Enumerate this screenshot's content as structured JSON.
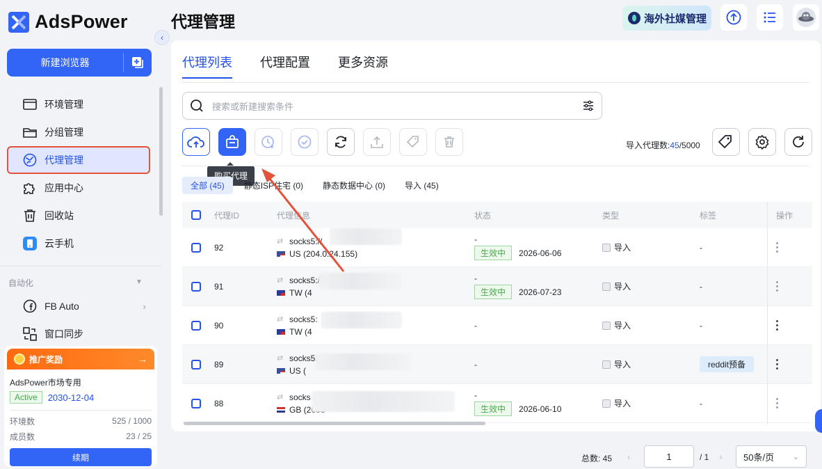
{
  "app": {
    "name": "AdsPower"
  },
  "sidebar": {
    "new_browser": "新建浏览器",
    "items": [
      {
        "label": "环境管理",
        "icon": "window-icon"
      },
      {
        "label": "分组管理",
        "icon": "folder-icon"
      },
      {
        "label": "代理管理",
        "icon": "proxy-icon",
        "active": true
      },
      {
        "label": "应用中心",
        "icon": "puzzle-icon"
      },
      {
        "label": "回收站",
        "icon": "trash-icon"
      },
      {
        "label": "云手机",
        "icon": "cloud-phone-icon"
      }
    ],
    "automation_label": "自动化",
    "auto_items": [
      {
        "label": "FB Auto",
        "icon": "facebook-icon"
      },
      {
        "label": "窗口同步",
        "icon": "sync-window-icon"
      }
    ]
  },
  "promo": {
    "title": "推广奖励",
    "plan_name": "AdsPower市场专用",
    "status": "Active",
    "expire": "2030-12-04",
    "env_label": "环境数",
    "env_value": "525 / 1000",
    "member_label": "成员数",
    "member_value": "23 / 25",
    "renew": "续期"
  },
  "header": {
    "title": "代理管理",
    "social_btn": "海外社媒管理"
  },
  "tabs": [
    "代理列表",
    "代理配置",
    "更多资源"
  ],
  "search": {
    "placeholder": "搜索或新建搜索条件"
  },
  "toolbar": {
    "tooltip": "购买代理",
    "import_label": "导入代理数:",
    "import_used": "45",
    "import_total": "/5000"
  },
  "filters": [
    {
      "label": "全部 (45)",
      "active": true
    },
    {
      "label": "静态ISP住宅 (0)"
    },
    {
      "label": "静态数据中心 (0)"
    },
    {
      "label": "导入 (45)"
    }
  ],
  "table": {
    "headers": {
      "id": "代理ID",
      "info": "代理信息",
      "status": "状态",
      "type": "类型",
      "tag": "标签",
      "op": "操作"
    },
    "rows": [
      {
        "id": "92",
        "proto": "socks5://",
        "loc": "US (204.0.24.155)",
        "flag": "us",
        "status_top": "-",
        "status": "生效中",
        "date": "2026-06-06",
        "type": "导入",
        "tag": "-"
      },
      {
        "id": "91",
        "proto": "socks5://",
        "loc": "TW (4",
        "flag": "tw",
        "status_top": "-",
        "status": "生效中",
        "date": "2026-07-23",
        "type": "导入",
        "tag": "-"
      },
      {
        "id": "90",
        "proto": "socks5:",
        "loc": "TW (4",
        "flag": "tw",
        "status_top": "",
        "status": "",
        "date": "",
        "status_single": "-",
        "type": "导入",
        "tag": "-"
      },
      {
        "id": "89",
        "proto": "socks5:",
        "loc": "US (",
        "flag": "us",
        "status_top": "",
        "status": "",
        "date": "",
        "status_single": "-",
        "type": "导入",
        "tag": "reddit预备"
      },
      {
        "id": "88",
        "proto": "socks",
        "loc": "GB (2603",
        "flag": "gb",
        "status_top": "-",
        "status": "生效中",
        "date": "2026-06-10",
        "type": "导入",
        "tag": "-"
      }
    ]
  },
  "pagination": {
    "total": "总数: 45",
    "page": "1",
    "pages": "/ 1",
    "size": "50条/页"
  },
  "colors": {
    "primary": "#3264f5",
    "annotation": "#e2533a",
    "success": "#49a84d"
  }
}
